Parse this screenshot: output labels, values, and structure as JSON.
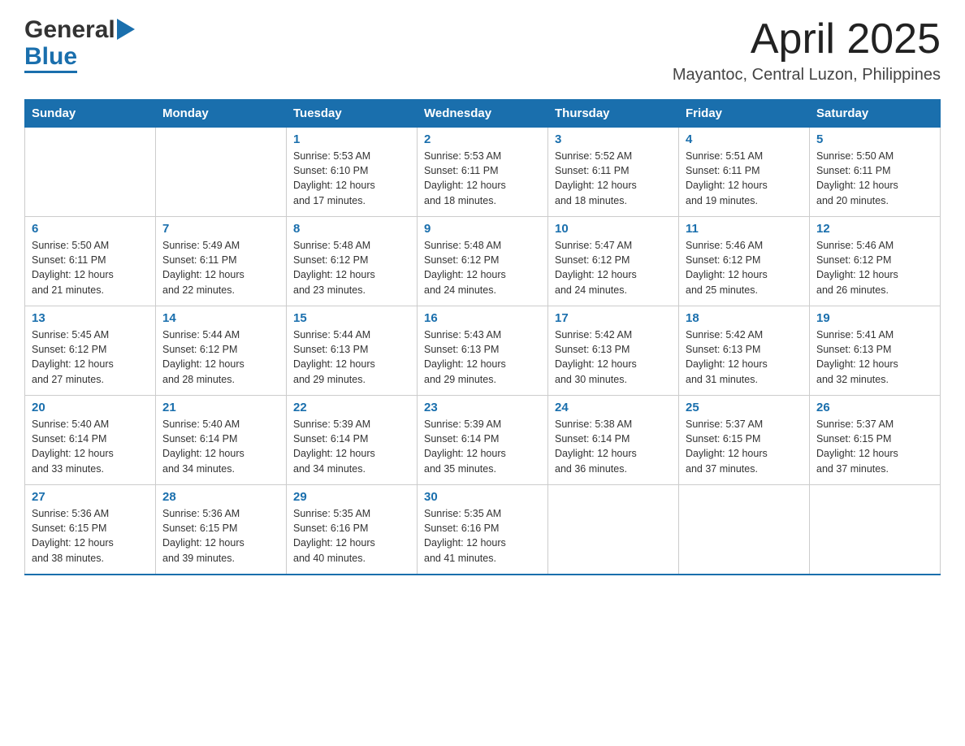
{
  "header": {
    "month_title": "April 2025",
    "location": "Mayantoc, Central Luzon, Philippines"
  },
  "days_of_week": [
    "Sunday",
    "Monday",
    "Tuesday",
    "Wednesday",
    "Thursday",
    "Friday",
    "Saturday"
  ],
  "weeks": [
    [
      {
        "day": "",
        "info": ""
      },
      {
        "day": "",
        "info": ""
      },
      {
        "day": "1",
        "info": "Sunrise: 5:53 AM\nSunset: 6:10 PM\nDaylight: 12 hours\nand 17 minutes."
      },
      {
        "day": "2",
        "info": "Sunrise: 5:53 AM\nSunset: 6:11 PM\nDaylight: 12 hours\nand 18 minutes."
      },
      {
        "day": "3",
        "info": "Sunrise: 5:52 AM\nSunset: 6:11 PM\nDaylight: 12 hours\nand 18 minutes."
      },
      {
        "day": "4",
        "info": "Sunrise: 5:51 AM\nSunset: 6:11 PM\nDaylight: 12 hours\nand 19 minutes."
      },
      {
        "day": "5",
        "info": "Sunrise: 5:50 AM\nSunset: 6:11 PM\nDaylight: 12 hours\nand 20 minutes."
      }
    ],
    [
      {
        "day": "6",
        "info": "Sunrise: 5:50 AM\nSunset: 6:11 PM\nDaylight: 12 hours\nand 21 minutes."
      },
      {
        "day": "7",
        "info": "Sunrise: 5:49 AM\nSunset: 6:11 PM\nDaylight: 12 hours\nand 22 minutes."
      },
      {
        "day": "8",
        "info": "Sunrise: 5:48 AM\nSunset: 6:12 PM\nDaylight: 12 hours\nand 23 minutes."
      },
      {
        "day": "9",
        "info": "Sunrise: 5:48 AM\nSunset: 6:12 PM\nDaylight: 12 hours\nand 24 minutes."
      },
      {
        "day": "10",
        "info": "Sunrise: 5:47 AM\nSunset: 6:12 PM\nDaylight: 12 hours\nand 24 minutes."
      },
      {
        "day": "11",
        "info": "Sunrise: 5:46 AM\nSunset: 6:12 PM\nDaylight: 12 hours\nand 25 minutes."
      },
      {
        "day": "12",
        "info": "Sunrise: 5:46 AM\nSunset: 6:12 PM\nDaylight: 12 hours\nand 26 minutes."
      }
    ],
    [
      {
        "day": "13",
        "info": "Sunrise: 5:45 AM\nSunset: 6:12 PM\nDaylight: 12 hours\nand 27 minutes."
      },
      {
        "day": "14",
        "info": "Sunrise: 5:44 AM\nSunset: 6:12 PM\nDaylight: 12 hours\nand 28 minutes."
      },
      {
        "day": "15",
        "info": "Sunrise: 5:44 AM\nSunset: 6:13 PM\nDaylight: 12 hours\nand 29 minutes."
      },
      {
        "day": "16",
        "info": "Sunrise: 5:43 AM\nSunset: 6:13 PM\nDaylight: 12 hours\nand 29 minutes."
      },
      {
        "day": "17",
        "info": "Sunrise: 5:42 AM\nSunset: 6:13 PM\nDaylight: 12 hours\nand 30 minutes."
      },
      {
        "day": "18",
        "info": "Sunrise: 5:42 AM\nSunset: 6:13 PM\nDaylight: 12 hours\nand 31 minutes."
      },
      {
        "day": "19",
        "info": "Sunrise: 5:41 AM\nSunset: 6:13 PM\nDaylight: 12 hours\nand 32 minutes."
      }
    ],
    [
      {
        "day": "20",
        "info": "Sunrise: 5:40 AM\nSunset: 6:14 PM\nDaylight: 12 hours\nand 33 minutes."
      },
      {
        "day": "21",
        "info": "Sunrise: 5:40 AM\nSunset: 6:14 PM\nDaylight: 12 hours\nand 34 minutes."
      },
      {
        "day": "22",
        "info": "Sunrise: 5:39 AM\nSunset: 6:14 PM\nDaylight: 12 hours\nand 34 minutes."
      },
      {
        "day": "23",
        "info": "Sunrise: 5:39 AM\nSunset: 6:14 PM\nDaylight: 12 hours\nand 35 minutes."
      },
      {
        "day": "24",
        "info": "Sunrise: 5:38 AM\nSunset: 6:14 PM\nDaylight: 12 hours\nand 36 minutes."
      },
      {
        "day": "25",
        "info": "Sunrise: 5:37 AM\nSunset: 6:15 PM\nDaylight: 12 hours\nand 37 minutes."
      },
      {
        "day": "26",
        "info": "Sunrise: 5:37 AM\nSunset: 6:15 PM\nDaylight: 12 hours\nand 37 minutes."
      }
    ],
    [
      {
        "day": "27",
        "info": "Sunrise: 5:36 AM\nSunset: 6:15 PM\nDaylight: 12 hours\nand 38 minutes."
      },
      {
        "day": "28",
        "info": "Sunrise: 5:36 AM\nSunset: 6:15 PM\nDaylight: 12 hours\nand 39 minutes."
      },
      {
        "day": "29",
        "info": "Sunrise: 5:35 AM\nSunset: 6:16 PM\nDaylight: 12 hours\nand 40 minutes."
      },
      {
        "day": "30",
        "info": "Sunrise: 5:35 AM\nSunset: 6:16 PM\nDaylight: 12 hours\nand 41 minutes."
      },
      {
        "day": "",
        "info": ""
      },
      {
        "day": "",
        "info": ""
      },
      {
        "day": "",
        "info": ""
      }
    ]
  ]
}
